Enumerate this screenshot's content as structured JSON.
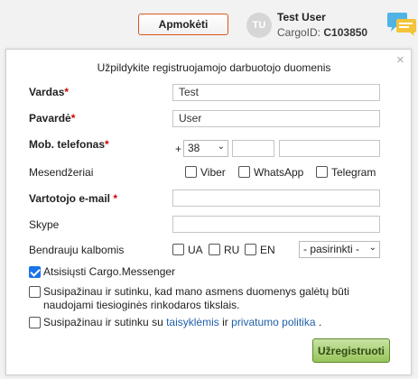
{
  "topbar": {
    "pay_label": "Apmokėti",
    "avatar_initials": "TU",
    "user_name": "Test User",
    "cargoid_prefix": "CargoID:",
    "cargoid_value": "C103850"
  },
  "modal": {
    "title": "Užpildykite registruojamojo darbuotojo duomenis",
    "close": "×",
    "first_name": {
      "label": "Vardas",
      "required": "*",
      "value": "Test"
    },
    "last_name": {
      "label": "Pavardė",
      "required": "*",
      "value": "User"
    },
    "phone": {
      "label": "Mob. telefonas",
      "required": "*",
      "plus": "+",
      "code": "38",
      "part1": "",
      "part2": ""
    },
    "messengers": {
      "label": "Mesendžeriai",
      "options": [
        "Viber",
        "WhatsApp",
        "Telegram"
      ]
    },
    "email": {
      "label": "Vartotojo e-mail",
      "required": "*",
      "value": ""
    },
    "skype": {
      "label": "Skype",
      "value": ""
    },
    "languages": {
      "label": "Bendrauju kalbomis",
      "options": [
        "UA",
        "RU",
        "EN"
      ],
      "select_placeholder": "- pasirinkti -"
    },
    "download_messenger": {
      "label": "Atsisiųsti Cargo.Messenger",
      "checked": true
    },
    "consent_data": {
      "label": "Susipažinau ir sutinku, kad mano asmens duomenys galėtų būti naudojami tiesioginės rinkodaros tikslais.",
      "checked": false
    },
    "consent_rules": {
      "prefix": "Susipažinau ir sutinku su",
      "rules_link": "taisyklėmis",
      "and": "ir",
      "privacy_link": "privatumo politika",
      "suffix": ".",
      "checked": false
    },
    "submit_label": "Užregistruoti"
  }
}
